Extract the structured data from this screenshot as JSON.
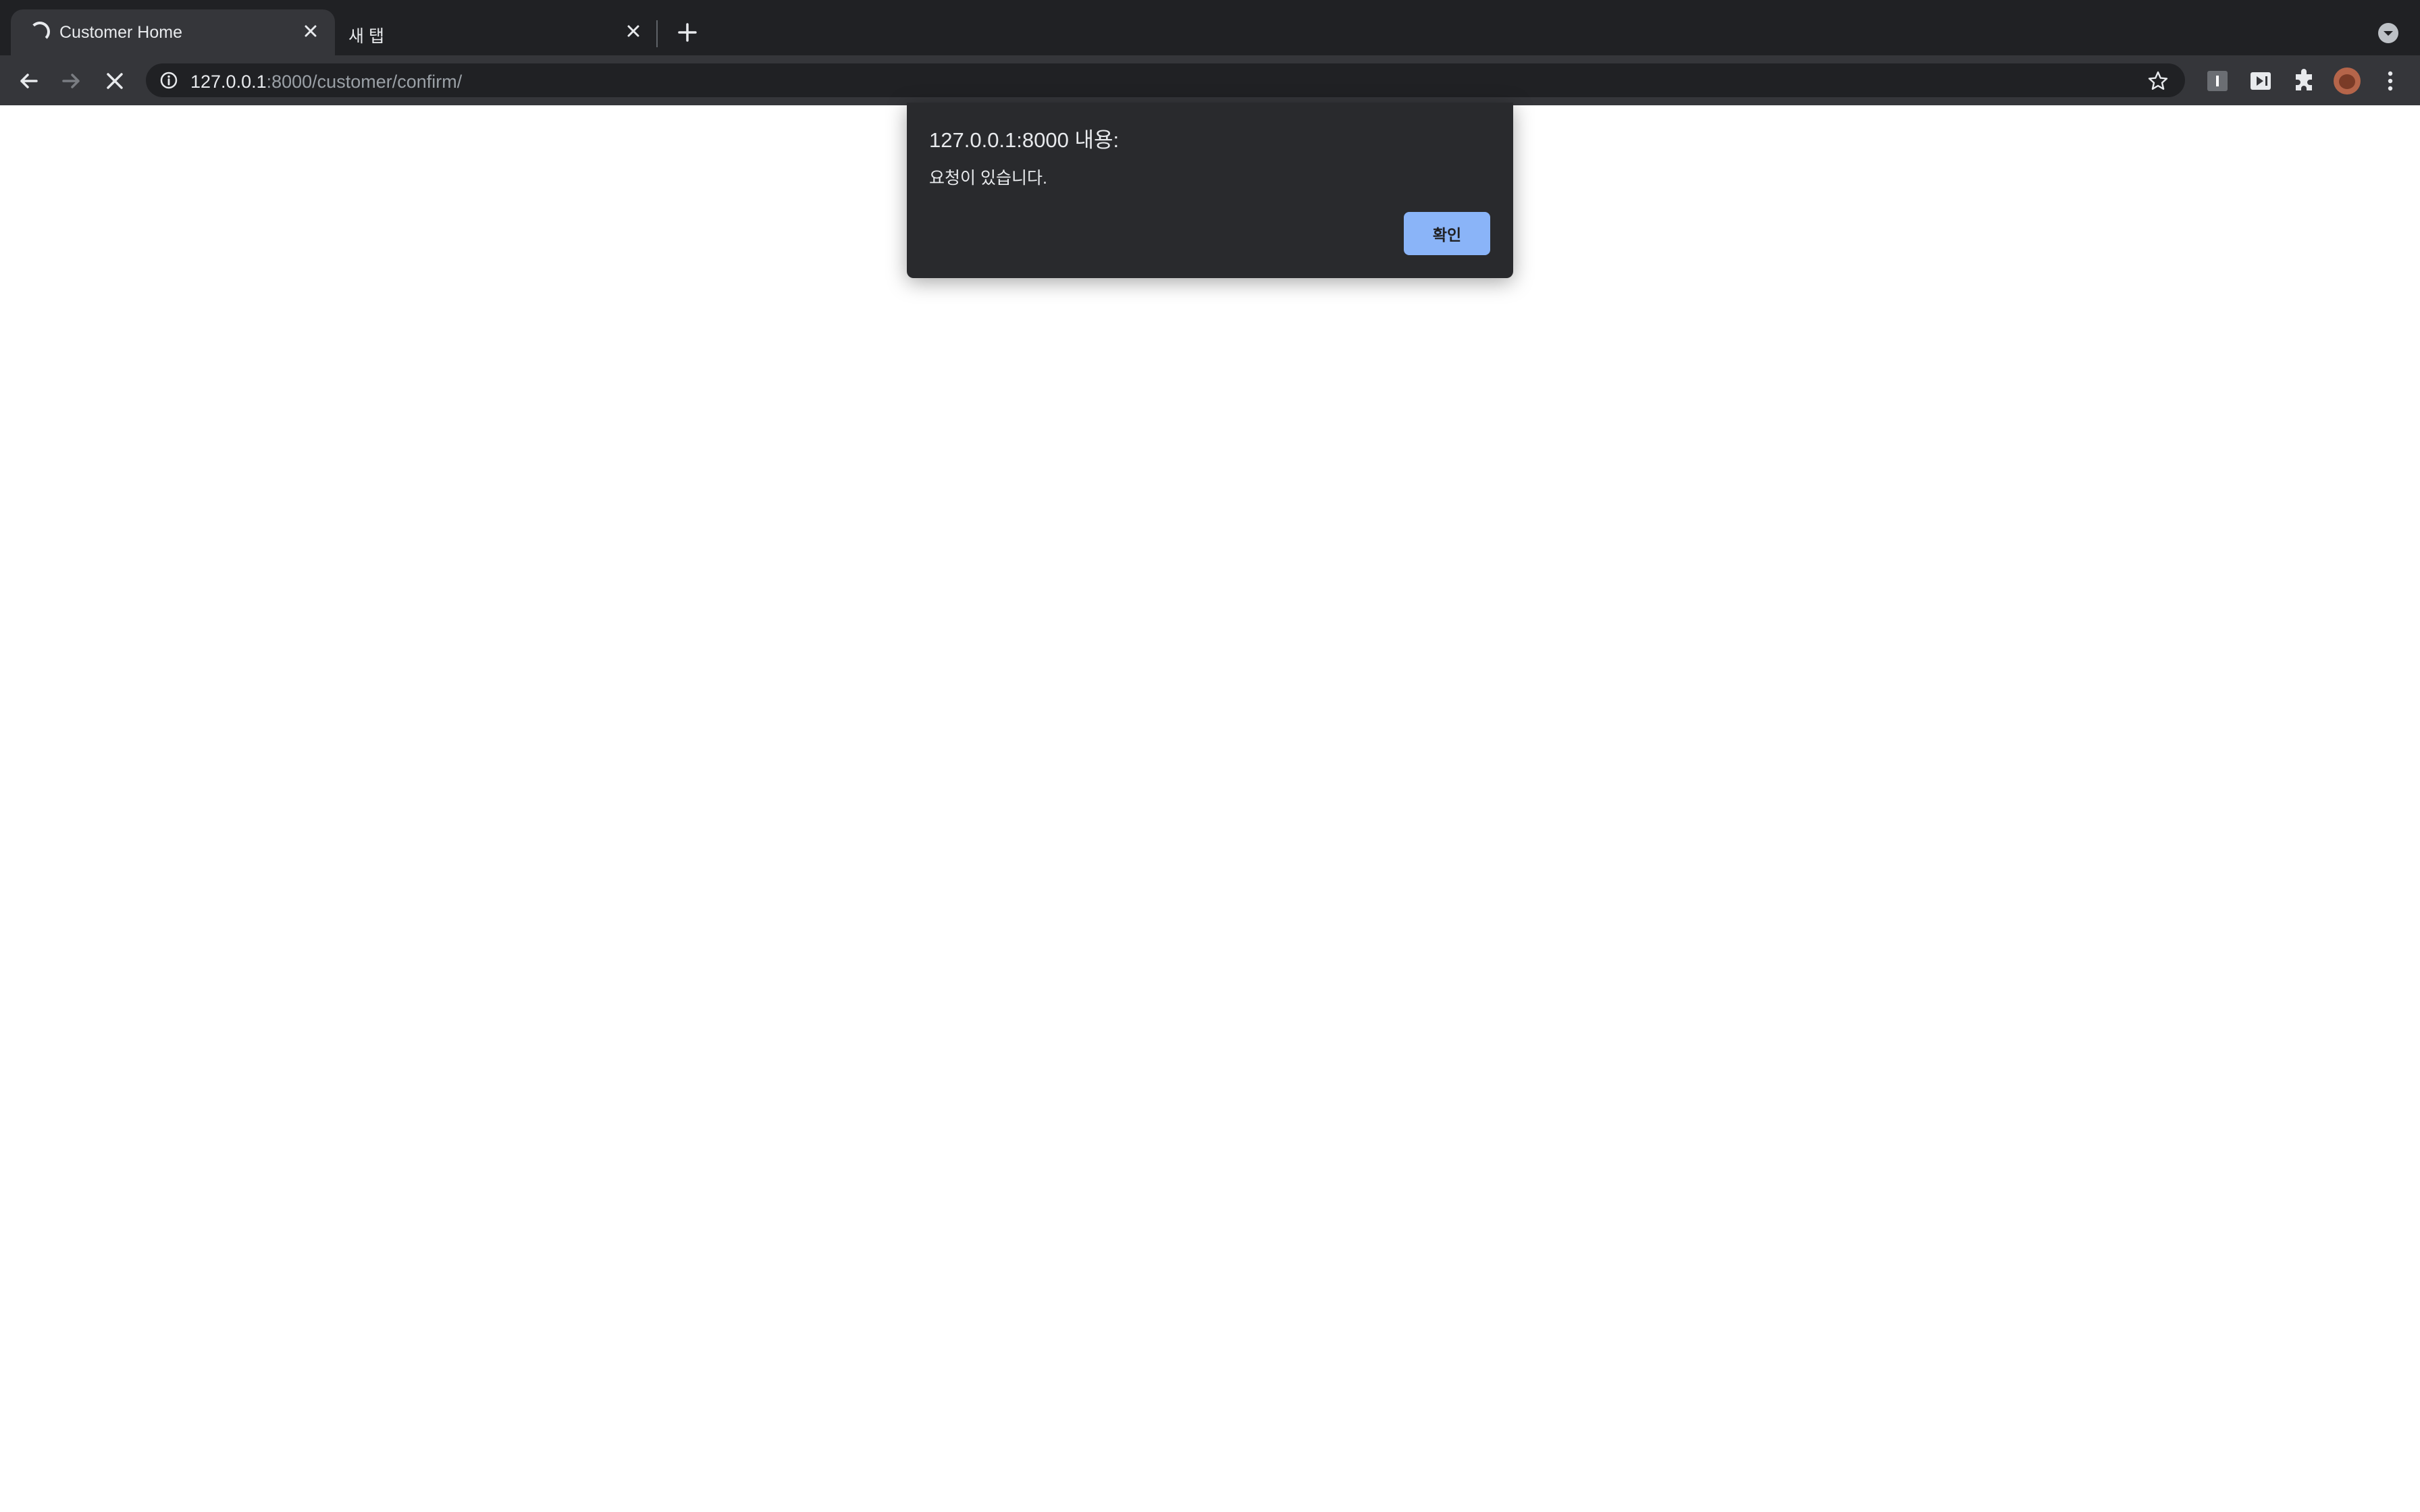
{
  "tabs": [
    {
      "title": "Customer Home",
      "active": true,
      "loading": true,
      "close_icon": "close-icon"
    },
    {
      "title": "새 탭",
      "active": false,
      "loading": false,
      "close_icon": "close-icon"
    }
  ],
  "toolbar": {
    "url_host": "127.0.0.1",
    "url_path": ":8000/customer/confirm/",
    "icons": [
      "back-arrow-icon",
      "forward-arrow-icon",
      "stop-loading-icon",
      "site-info-icon",
      "bookmark-star-icon",
      "extension-icon",
      "media-extension-icon",
      "puzzle-icon",
      "profile-avatar",
      "more-menu-icon"
    ]
  },
  "dialog": {
    "title": "127.0.0.1:8000 내용:",
    "message": "요청이 있습니다.",
    "ok_label": "확인"
  },
  "colors": {
    "tabstrip_bg": "#202124",
    "toolbar_bg": "#35363a",
    "dialog_bg": "#292a2d",
    "button_accent": "#8ab4f8"
  }
}
